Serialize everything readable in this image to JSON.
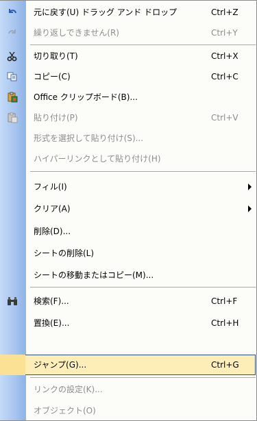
{
  "menu": {
    "items": [
      {
        "label": "元に戻す(U) ドラッグ アンド ドロップ",
        "shortcut": "Ctrl+Z",
        "icon": "undo-icon",
        "disabled": false
      },
      {
        "label": "繰り返しできません(R)",
        "shortcut": "Ctrl+Y",
        "icon": "redo-icon",
        "disabled": true
      },
      {
        "label": "切り取り(T)",
        "shortcut": "Ctrl+X",
        "icon": "scissors-icon",
        "disabled": false
      },
      {
        "label": "コピー(C)",
        "shortcut": "Ctrl+C",
        "icon": "copy-icon",
        "disabled": false
      },
      {
        "label": "Office クリップボード(B)...",
        "shortcut": "",
        "icon": "clipboard-icon",
        "disabled": false
      },
      {
        "label": "貼り付け(P)",
        "shortcut": "Ctrl+V",
        "icon": "paste-icon",
        "disabled": true
      },
      {
        "label": "形式を選択して貼り付け(S)...",
        "shortcut": "",
        "icon": "",
        "disabled": true
      },
      {
        "label": "ハイパーリンクとして貼り付け(H)",
        "shortcut": "",
        "icon": "",
        "disabled": true
      },
      {
        "label": "フィル(I)",
        "shortcut": "",
        "icon": "",
        "disabled": false,
        "submenu": true
      },
      {
        "label": "クリア(A)",
        "shortcut": "",
        "icon": "",
        "disabled": false,
        "submenu": true
      },
      {
        "label": "削除(D)...",
        "shortcut": "",
        "icon": "",
        "disabled": false
      },
      {
        "label": "シートの削除(L)",
        "shortcut": "",
        "icon": "",
        "disabled": false
      },
      {
        "label": "シートの移動またはコピー(M)...",
        "shortcut": "",
        "icon": "",
        "disabled": false
      },
      {
        "label": "検索(F)...",
        "shortcut": "Ctrl+F",
        "icon": "binoculars-icon",
        "disabled": false
      },
      {
        "label": "置換(E)...",
        "shortcut": "Ctrl+H",
        "icon": "",
        "disabled": false
      },
      {
        "label": "ジャンプ(G)...",
        "shortcut": "Ctrl+G",
        "icon": "",
        "disabled": false,
        "highlighted": true
      },
      {
        "label": "リンクの設定(K)...",
        "shortcut": "",
        "icon": "",
        "disabled": true
      },
      {
        "label": "オブジェクト(O)",
        "shortcut": "",
        "icon": "",
        "disabled": true
      }
    ]
  },
  "colors": {
    "gutter": "#a7c5ef",
    "highlight": "#fdeeb8",
    "highlight_border": "#2f4b86",
    "disabled_text": "#8d8d8d"
  }
}
